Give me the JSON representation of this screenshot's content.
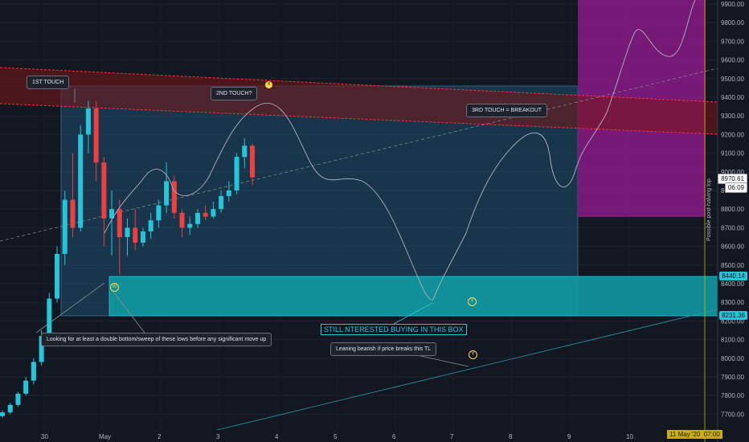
{
  "chart_data": {
    "type": "candlestick",
    "symbol_price_axis": {
      "ylim": [
        7650,
        10000
      ],
      "ticks": [
        9900,
        9800,
        9700,
        9600,
        9500,
        9400,
        9300,
        9200,
        9100,
        9000,
        8900,
        8800,
        8700,
        8600,
        8500,
        8400,
        8300,
        8200,
        8100,
        8000,
        7900,
        7800,
        7700
      ],
      "tick_labels": [
        "9900.00",
        "9800.00",
        "9700.00",
        "9600.00",
        "9500.00",
        "9400.00",
        "9300.00",
        "9200.00",
        "9100.00",
        "9000.00",
        "8900.00",
        "8800.00",
        "8700.00",
        "8600.00",
        "8500.00",
        "8400.00",
        "8300.00",
        "8200.00",
        "8100.00",
        "8000.00",
        "7900.00",
        "7800.00",
        "7700.00"
      ]
    },
    "x_axis": {
      "tick_labels": [
        "30",
        "May",
        "2",
        "3",
        "4",
        "5",
        "6",
        "7",
        "8",
        "9",
        "10"
      ],
      "highlight_label": "11 May '20",
      "highlight_time": "07:00"
    },
    "current_price": "8970.61",
    "countdown": "06:09",
    "box_top_price": "8440.14",
    "box_bottom_price": "8231.36",
    "colors": {
      "up": "#26c6da",
      "down": "#ef3f3f",
      "resistance": "#ff3030",
      "box": "#1e6f8a",
      "buy_zone": "#10a0a8",
      "target": "#8a1a86",
      "path": "#b0b3bd"
    },
    "candles_approx": [
      {
        "t": 0,
        "o": 7690,
        "h": 7720,
        "c": 7710,
        "l": 7680
      },
      {
        "t": 1,
        "o": 7710,
        "h": 7760,
        "c": 7750,
        "l": 7700
      },
      {
        "t": 2,
        "o": 7750,
        "h": 7820,
        "c": 7810,
        "l": 7740
      },
      {
        "t": 3,
        "o": 7810,
        "h": 7900,
        "c": 7880,
        "l": 7800
      },
      {
        "t": 4,
        "o": 7880,
        "h": 8000,
        "c": 7980,
        "l": 7860
      },
      {
        "t": 5,
        "o": 7980,
        "h": 8150,
        "c": 8120,
        "l": 7960
      },
      {
        "t": 6,
        "o": 8120,
        "h": 8350,
        "c": 8320,
        "l": 8100
      },
      {
        "t": 7,
        "o": 8320,
        "h": 8600,
        "c": 8560,
        "l": 8300
      },
      {
        "t": 8,
        "o": 8560,
        "h": 8900,
        "c": 8850,
        "l": 8500
      },
      {
        "t": 9,
        "o": 8850,
        "h": 9100,
        "c": 8700,
        "l": 8650
      },
      {
        "t": 10,
        "o": 8700,
        "h": 9250,
        "c": 9200,
        "l": 8680
      },
      {
        "t": 11,
        "o": 9200,
        "h": 9380,
        "c": 9340,
        "l": 9100
      },
      {
        "t": 12,
        "o": 9340,
        "h": 9380,
        "c": 9050,
        "l": 8950
      },
      {
        "t": 13,
        "o": 9050,
        "h": 9080,
        "c": 8750,
        "l": 8600
      },
      {
        "t": 14,
        "o": 8750,
        "h": 8900,
        "c": 8800,
        "l": 8550
      },
      {
        "t": 15,
        "o": 8800,
        "h": 8850,
        "c": 8650,
        "l": 8450
      },
      {
        "t": 16,
        "o": 8650,
        "h": 8750,
        "c": 8700,
        "l": 8550
      },
      {
        "t": 17,
        "o": 8700,
        "h": 8800,
        "c": 8620,
        "l": 8580
      },
      {
        "t": 18,
        "o": 8620,
        "h": 8700,
        "c": 8680,
        "l": 8600
      },
      {
        "t": 19,
        "o": 8680,
        "h": 8780,
        "c": 8740,
        "l": 8640
      },
      {
        "t": 20,
        "o": 8740,
        "h": 8850,
        "c": 8820,
        "l": 8700
      },
      {
        "t": 21,
        "o": 8820,
        "h": 9050,
        "c": 8950,
        "l": 8780
      },
      {
        "t": 22,
        "o": 8950,
        "h": 8980,
        "c": 8780,
        "l": 8750
      },
      {
        "t": 23,
        "o": 8780,
        "h": 8800,
        "c": 8700,
        "l": 8650
      },
      {
        "t": 24,
        "o": 8700,
        "h": 8760,
        "c": 8720,
        "l": 8660
      },
      {
        "t": 25,
        "o": 8720,
        "h": 8800,
        "c": 8780,
        "l": 8700
      },
      {
        "t": 26,
        "o": 8780,
        "h": 8820,
        "c": 8760,
        "l": 8740
      },
      {
        "t": 27,
        "o": 8760,
        "h": 8840,
        "c": 8800,
        "l": 8750
      },
      {
        "t": 28,
        "o": 8800,
        "h": 8900,
        "c": 8870,
        "l": 8780
      },
      {
        "t": 29,
        "o": 8870,
        "h": 8950,
        "c": 8900,
        "l": 8840
      },
      {
        "t": 30,
        "o": 8900,
        "h": 9100,
        "c": 9080,
        "l": 8880
      },
      {
        "t": 31,
        "o": 9080,
        "h": 9180,
        "c": 9140,
        "l": 9020
      },
      {
        "t": 32,
        "o": 9140,
        "h": 9150,
        "c": 8970,
        "l": 8930
      }
    ]
  },
  "annotations": {
    "first_touch": "1ST TOUCH",
    "second_touch": "2ND TOUCH?",
    "third_touch": "3RD TOUCH = BREAKOUT",
    "double_bottom": "Looking for at least a double bottom/sweep of these lows before any significant move up",
    "bearish": "Leaning bearish if price breaks this TL",
    "buy_box": "STILL NTERESTED BUYING IN THIS BOX",
    "halving_top": "Possible post-halving top",
    "marker_x": "X",
    "marker_w": "W",
    "marker_y1": "Y",
    "marker_y2": "Y"
  }
}
